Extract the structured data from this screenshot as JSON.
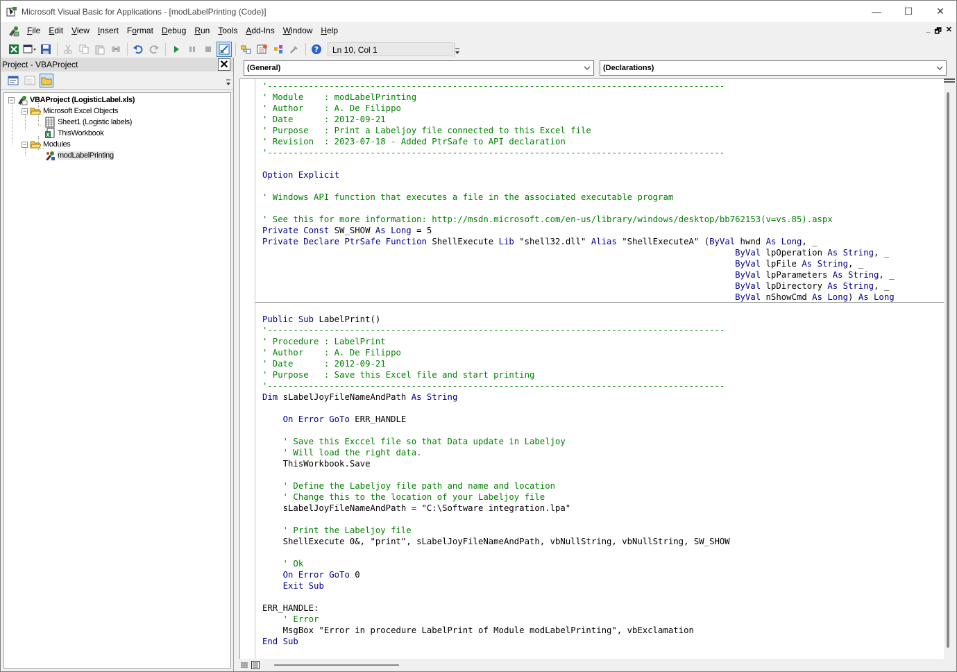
{
  "window": {
    "title": "Microsoft Visual Basic for Applications - [modLabelPrinting (Code)]",
    "controls": {
      "minimize": "—",
      "maximize": "☐",
      "close": "✕"
    }
  },
  "menu": {
    "items": [
      {
        "label": "File",
        "key": "F"
      },
      {
        "label": "Edit",
        "key": "E"
      },
      {
        "label": "View",
        "key": "V"
      },
      {
        "label": "Insert",
        "key": "I"
      },
      {
        "label": "Format",
        "key": "o"
      },
      {
        "label": "Debug",
        "key": "D"
      },
      {
        "label": "Run",
        "key": "R"
      },
      {
        "label": "Tools",
        "key": "T"
      },
      {
        "label": "Add-Ins",
        "key": "A"
      },
      {
        "label": "Window",
        "key": "W"
      },
      {
        "label": "Help",
        "key": "H"
      }
    ],
    "mdi": {
      "minimize": "_",
      "restore": "🗗",
      "close": "✕"
    }
  },
  "toolbar": {
    "position": "Ln 10, Col 1"
  },
  "project": {
    "title": "Project - VBAProject",
    "close": "✕",
    "tree": {
      "root": "VBAProject (LogisticLabel.xls)",
      "excel_objects": "Microsoft Excel Objects",
      "sheet1": "Sheet1 (Logistic labels)",
      "workbook": "ThisWorkbook",
      "modules": "Modules",
      "module1": "modLabelPrinting"
    }
  },
  "code": {
    "object_combo": "(General)",
    "proc_combo": "(Declarations)",
    "sections": [
      [
        [
          [
            "cm",
            "'-----------------------------------------------------------------------------------------"
          ]
        ],
        [
          [
            "cm",
            "' Module    : modLabelPrinting"
          ]
        ],
        [
          [
            "cm",
            "' Author    : A. De Filippo"
          ]
        ],
        [
          [
            "cm",
            "' Date      : 2012-09-21"
          ]
        ],
        [
          [
            "cm",
            "' Purpose   : Print a Labeljoy file connected to this Excel file"
          ]
        ],
        [
          [
            "cm",
            "' Revision  : 2023-07-18 - Added PtrSafe to API declaration"
          ]
        ],
        [
          [
            "cm",
            "'-----------------------------------------------------------------------------------------"
          ]
        ],
        [],
        [
          [
            "kw",
            "Option Explicit"
          ]
        ],
        [],
        [
          [
            "cm",
            "' Windows API function that executes a file in the associated executable program"
          ]
        ],
        [],
        [
          [
            "cm",
            "' See this for more information: http://msdn.microsoft.com/en-us/library/windows/desktop/bb762153(v=vs.85).aspx"
          ]
        ],
        [
          [
            "kw",
            "Private Const "
          ],
          [
            "tx",
            "SW_SHOW "
          ],
          [
            "kw",
            "As Long"
          ],
          [
            "tx",
            " = 5"
          ]
        ],
        [
          [
            "kw",
            "Private Declare PtrSafe Function "
          ],
          [
            "tx",
            "ShellExecute "
          ],
          [
            "kw",
            "Lib "
          ],
          [
            "tx",
            "\"shell32.dll\" "
          ],
          [
            "kw",
            "Alias "
          ],
          [
            "tx",
            "\"ShellExecuteA\" ("
          ],
          [
            "kw",
            "ByVal "
          ],
          [
            "tx",
            "hwnd "
          ],
          [
            "kw",
            "As Long"
          ],
          [
            "tx",
            ", _"
          ]
        ],
        [
          [
            "tx",
            "                                                                                            "
          ],
          [
            "kw",
            "ByVal "
          ],
          [
            "tx",
            "lpOperation "
          ],
          [
            "kw",
            "As String"
          ],
          [
            "tx",
            ", _"
          ]
        ],
        [
          [
            "tx",
            "                                                                                            "
          ],
          [
            "kw",
            "ByVal "
          ],
          [
            "tx",
            "lpFile "
          ],
          [
            "kw",
            "As String"
          ],
          [
            "tx",
            ", _"
          ]
        ],
        [
          [
            "tx",
            "                                                                                            "
          ],
          [
            "kw",
            "ByVal "
          ],
          [
            "tx",
            "lpParameters "
          ],
          [
            "kw",
            "As String"
          ],
          [
            "tx",
            ", _"
          ]
        ],
        [
          [
            "tx",
            "                                                                                            "
          ],
          [
            "kw",
            "ByVal "
          ],
          [
            "tx",
            "lpDirectory "
          ],
          [
            "kw",
            "As String"
          ],
          [
            "tx",
            ", _"
          ]
        ],
        [
          [
            "tx",
            "                                                                                            "
          ],
          [
            "kw",
            "ByVal "
          ],
          [
            "tx",
            "nShowCmd "
          ],
          [
            "kw",
            "As Long"
          ],
          [
            "tx",
            ") "
          ],
          [
            "kw",
            "As Long"
          ]
        ]
      ],
      [
        [],
        [
          [
            "kw",
            "Public Sub "
          ],
          [
            "tx",
            "LabelPrint()"
          ]
        ],
        [
          [
            "cm",
            "'-----------------------------------------------------------------------------------------"
          ]
        ],
        [
          [
            "cm",
            "' Procedure : LabelPrint"
          ]
        ],
        [
          [
            "cm",
            "' Author    : A. De Filippo"
          ]
        ],
        [
          [
            "cm",
            "' Date      : 2012-09-21"
          ]
        ],
        [
          [
            "cm",
            "' Purpose   : Save this Excel file and start printing"
          ]
        ],
        [
          [
            "cm",
            "'-----------------------------------------------------------------------------------------"
          ]
        ],
        [
          [
            "kw",
            "Dim "
          ],
          [
            "tx",
            "sLabelJoyFileNameAndPath "
          ],
          [
            "kw",
            "As String"
          ]
        ],
        [],
        [
          [
            "tx",
            "    "
          ],
          [
            "kw",
            "On Error GoTo "
          ],
          [
            "tx",
            "ERR_HANDLE"
          ]
        ],
        [],
        [
          [
            "tx",
            "    "
          ],
          [
            "cm",
            "' Save this Exccel file so that Data update in Labeljoy"
          ]
        ],
        [
          [
            "tx",
            "    "
          ],
          [
            "cm",
            "' Will load the right data."
          ]
        ],
        [
          [
            "tx",
            "    ThisWorkbook.Save"
          ]
        ],
        [],
        [
          [
            "tx",
            "    "
          ],
          [
            "cm",
            "' Define the Labeljoy file path and name and location"
          ]
        ],
        [
          [
            "tx",
            "    "
          ],
          [
            "cm",
            "' Change this to the location of your Labeljoy file"
          ]
        ],
        [
          [
            "tx",
            "    sLabelJoyFileNameAndPath = \"C:\\Software integration.lpa\""
          ]
        ],
        [],
        [
          [
            "tx",
            "    "
          ],
          [
            "cm",
            "' Print the Labeljoy file"
          ]
        ],
        [
          [
            "tx",
            "    ShellExecute 0&, \"print\", sLabelJoyFileNameAndPath, vbNullString, vbNullString, SW_SHOW"
          ]
        ],
        [],
        [
          [
            "tx",
            "    "
          ],
          [
            "cm",
            "' Ok"
          ]
        ],
        [
          [
            "tx",
            "    "
          ],
          [
            "kw",
            "On Error GoTo "
          ],
          [
            "tx",
            "0"
          ]
        ],
        [
          [
            "tx",
            "    "
          ],
          [
            "kw",
            "Exit Sub"
          ]
        ],
        [],
        [
          [
            "tx",
            "ERR_HANDLE:"
          ]
        ],
        [
          [
            "tx",
            "    "
          ],
          [
            "cm",
            "' Error"
          ]
        ],
        [
          [
            "tx",
            "    MsgBox \"Error in procedure LabelPrint of Module modLabelPrinting\", vbExclamation"
          ]
        ],
        [
          [
            "kw",
            "End Sub"
          ]
        ]
      ]
    ]
  }
}
